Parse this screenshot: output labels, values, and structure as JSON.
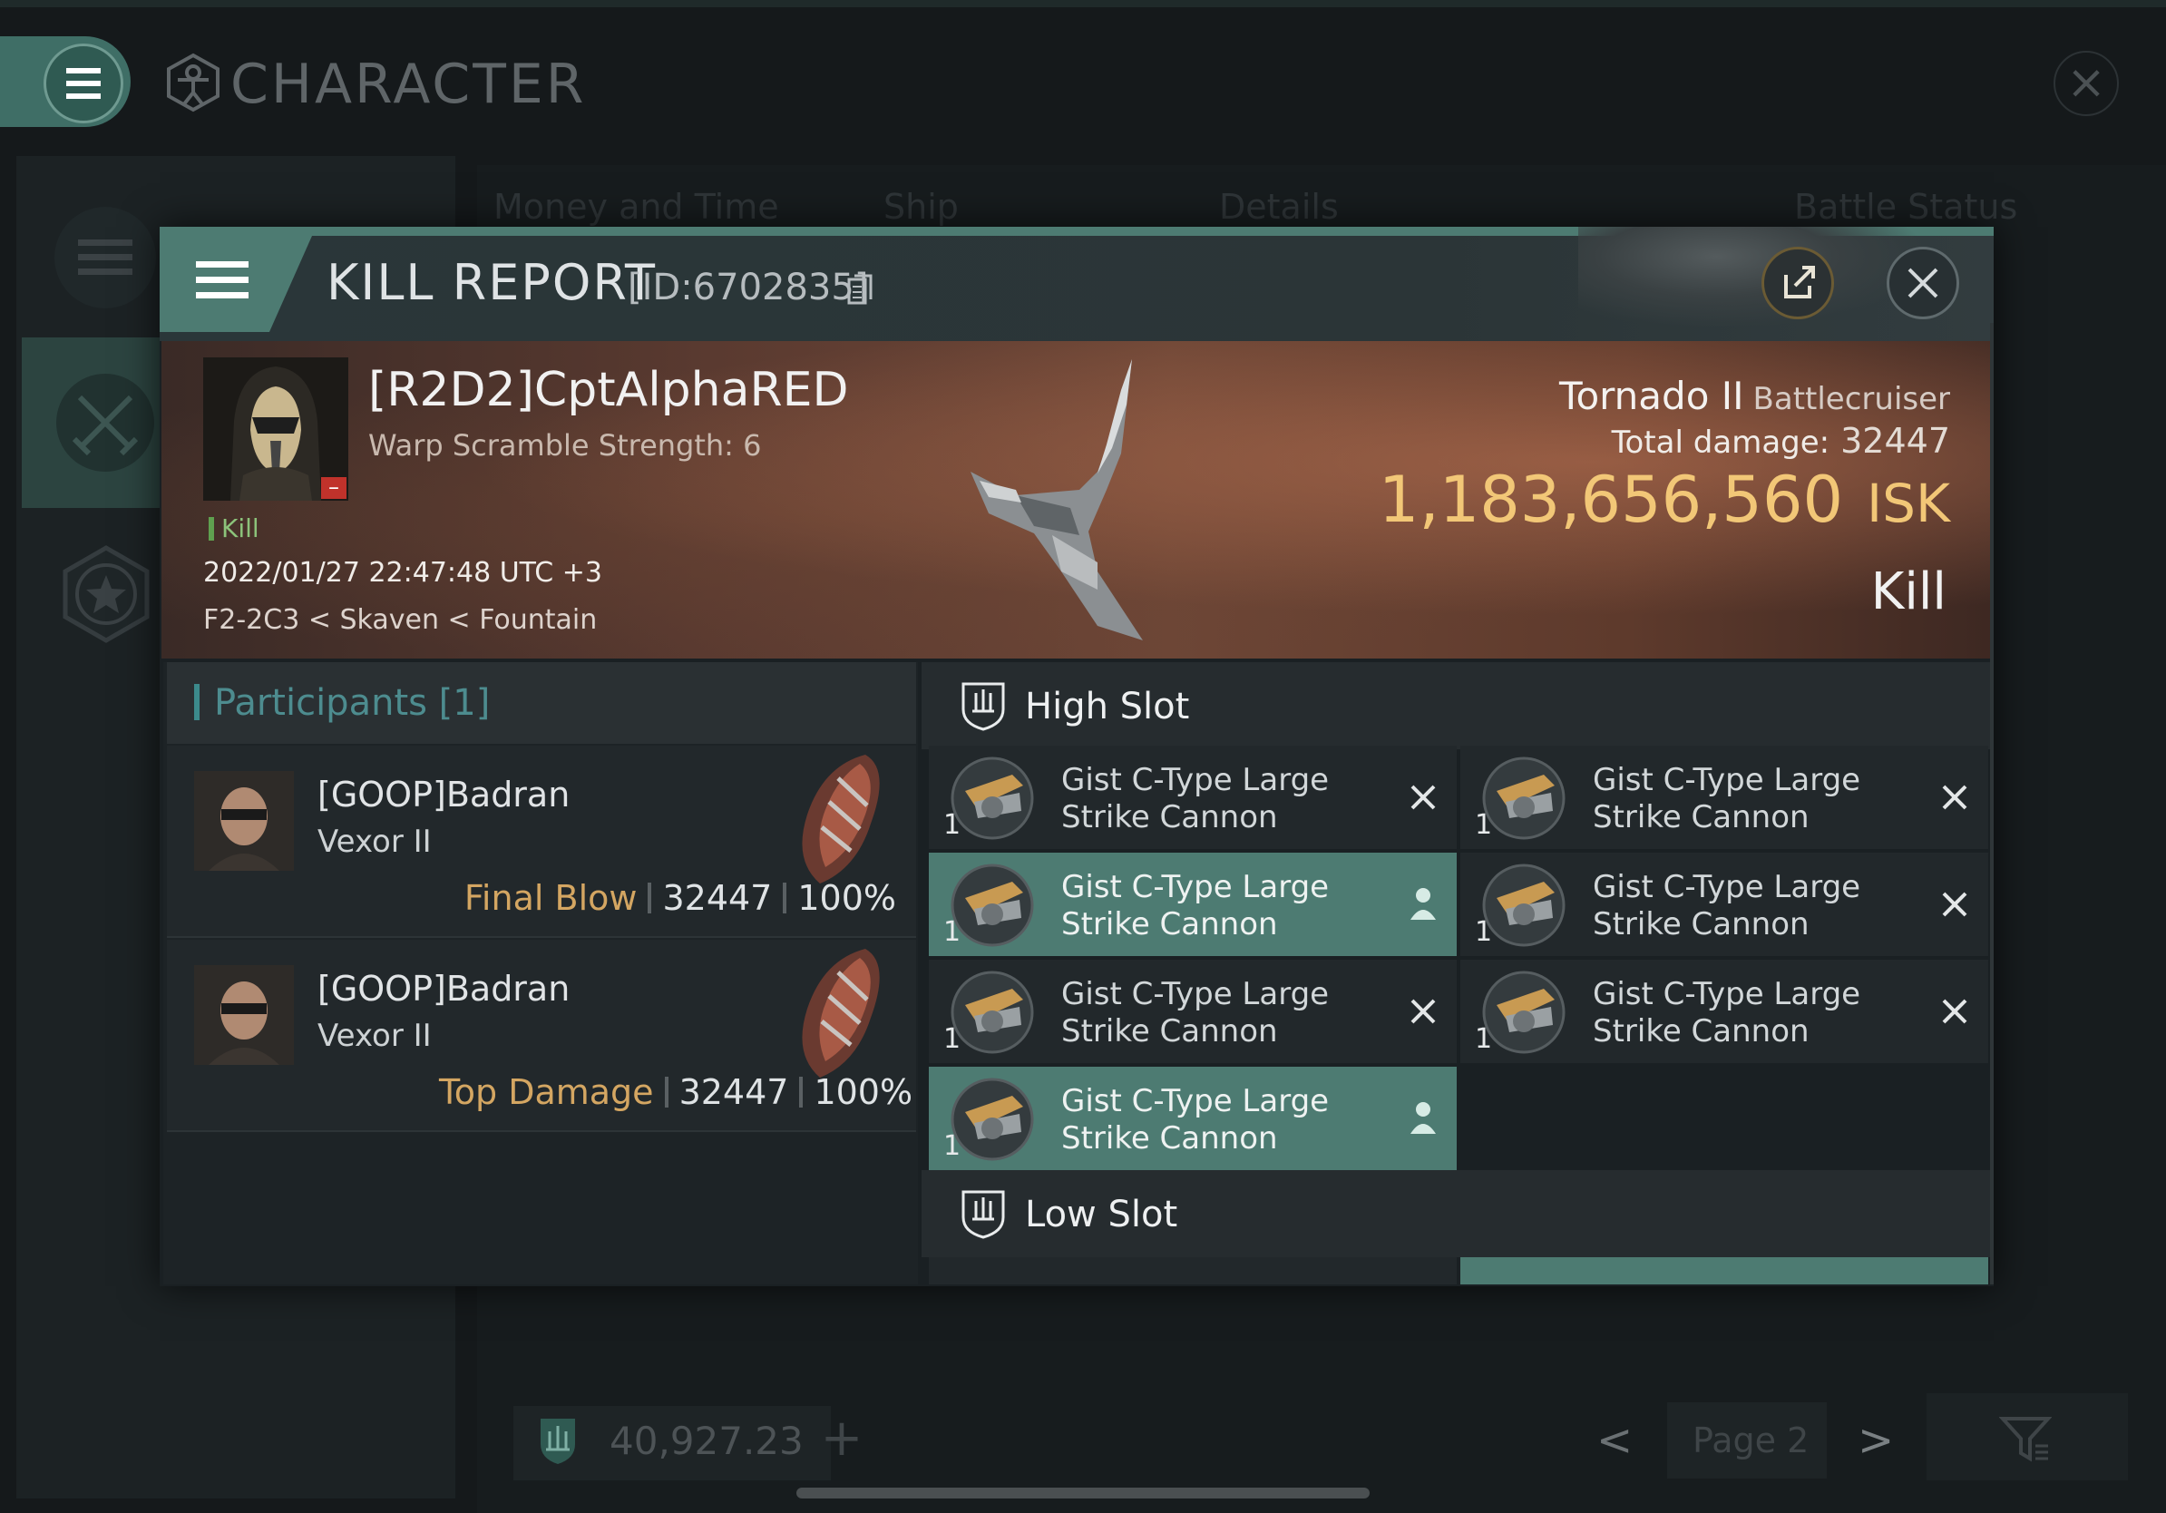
{
  "background_screen": {
    "title": "CHARACTER",
    "columns": [
      "Money and Time",
      "Ship",
      "Details",
      "Battle Status"
    ],
    "footer": {
      "isk_value": "40,927.23",
      "add_label": "+",
      "page_label": "Page 2"
    }
  },
  "kill_report": {
    "title": "KILL REPORT",
    "id_label": "[ID:6702835]",
    "victim": {
      "name": "[R2D2]CptAlphaRED",
      "subtitle": "Warp Scramble Strength: 6",
      "tag": "Kill",
      "datetime": "2022/01/27 22:47:48 UTC +3",
      "location": "F2-2C3 < Skaven < Fountain",
      "ship_name": "Tornado II",
      "ship_class": "Battlecruiser",
      "total_damage_label": "Total damage:",
      "total_damage_value": "32447",
      "isk_value": "1,183,656,560",
      "isk_unit": "ISK",
      "result": "Kill"
    },
    "participants": {
      "title": "Participants [1]",
      "rows": [
        {
          "name": "[GOOP]Badran",
          "ship": "Vexor II",
          "label": "Final Blow",
          "damage": "32447",
          "percent": "100%"
        },
        {
          "name": "[GOOP]Badran",
          "ship": "Vexor II",
          "label": "Top Damage",
          "damage": "32447",
          "percent": "100%"
        }
      ]
    },
    "slots": {
      "high_title": "High Slot",
      "low_title": "Low Slot",
      "high_modules": [
        {
          "line1": "Gist C-Type Large",
          "line2": "Strike Cannon",
          "qty": "1",
          "status": "destroyed"
        },
        {
          "line1": "Gist C-Type Large",
          "line2": "Strike Cannon",
          "qty": "1",
          "status": "destroyed"
        },
        {
          "line1": "Gist C-Type Large",
          "line2": "Strike Cannon",
          "qty": "1",
          "status": "dropped"
        },
        {
          "line1": "Gist C-Type Large",
          "line2": "Strike Cannon",
          "qty": "1",
          "status": "destroyed"
        },
        {
          "line1": "Gist C-Type Large",
          "line2": "Strike Cannon",
          "qty": "1",
          "status": "destroyed"
        },
        {
          "line1": "Gist C-Type Large",
          "line2": "Strike Cannon",
          "qty": "1",
          "status": "destroyed"
        },
        {
          "line1": "Gist C-Type Large",
          "line2": "Strike Cannon",
          "qty": "1",
          "status": "dropped"
        }
      ]
    }
  },
  "colors": {
    "accent_teal": "#4d7b72",
    "isk_gold": "#f2c777",
    "participant_label": "#d4a662",
    "participants_title": "#4d8c8f"
  }
}
